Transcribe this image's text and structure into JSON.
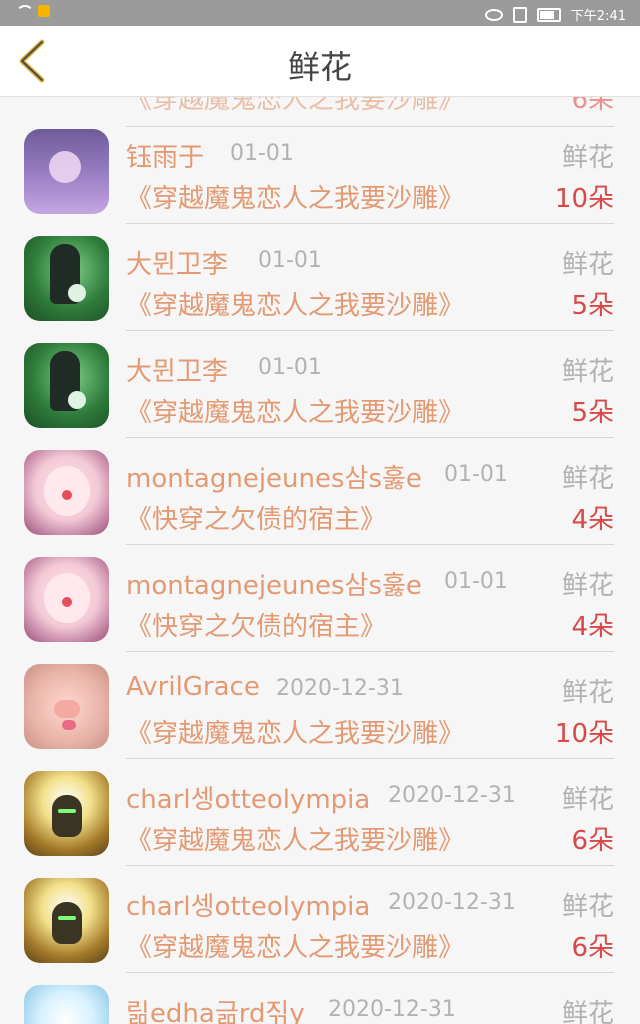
{
  "status_bar": {
    "time": "下午2:41",
    "icons": [
      "wifi-icon",
      "notification-icon",
      "eye-icon",
      "vibrate-icon",
      "battery-icon"
    ]
  },
  "header": {
    "title": "鲜花",
    "back_icon": "chevron-left-icon"
  },
  "partial_row": {
    "book": "《穿越魔鬼恋人之我要沙雕》",
    "count": "6朵"
  },
  "rows": [
    {
      "name": "钰雨于",
      "date": "01-01",
      "type": "鲜花",
      "book": "《穿越魔鬼恋人之我要沙雕》",
      "count": "10朵"
    },
    {
      "name": "大뮌卫李",
      "date": "01-01",
      "type": "鲜花",
      "book": "《穿越魔鬼恋人之我要沙雕》",
      "count": "5朵"
    },
    {
      "name": "大뮌卫李",
      "date": "01-01",
      "type": "鲜花",
      "book": "《穿越魔鬼恋人之我要沙雕》",
      "count": "5朵"
    },
    {
      "name": "montagnejeunes삼s훓e",
      "date": "01-01",
      "type": "鲜花",
      "book": "《快穿之欠债的宿主》",
      "count": "4朵"
    },
    {
      "name": "montagnejeunes삼s훓e",
      "date": "01-01",
      "type": "鲜花",
      "book": "《快穿之欠债的宿主》",
      "count": "4朵"
    },
    {
      "name": "AvrilGrace",
      "date": "2020-12-31",
      "type": "鲜花",
      "book": "《穿越魔鬼恋人之我要沙雕》",
      "count": "10朵"
    },
    {
      "name": "charl셍otteolympia",
      "date": "2020-12-31",
      "type": "鲜花",
      "book": "《穿越魔鬼恋人之我要沙雕》",
      "count": "6朵"
    },
    {
      "name": "charl셍otteolympia",
      "date": "2020-12-31",
      "type": "鲜花",
      "book": "《穿越魔鬼恋人之我要沙雕》",
      "count": "6朵"
    },
    {
      "name": "릶edha긂rd짂y",
      "date": "2020-12-31",
      "type": "鲜花",
      "book": "",
      "count": ""
    }
  ],
  "colors": {
    "name": "#e39a72",
    "count": "#d94848",
    "muted": "#b2b2b2",
    "back_icon": "#e0b13a"
  }
}
